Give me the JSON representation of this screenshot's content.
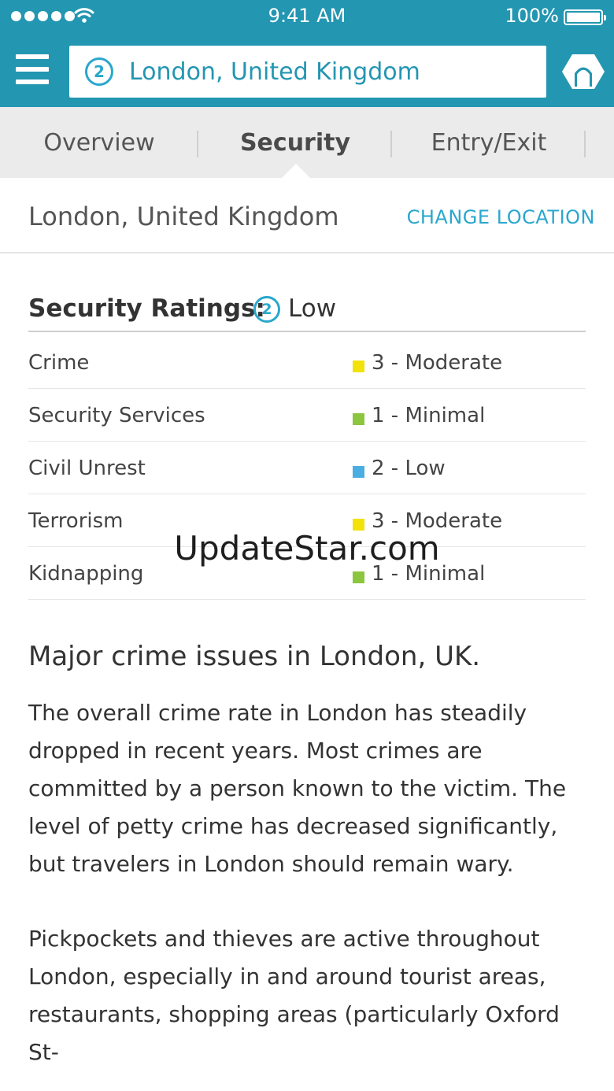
{
  "status_bar": {
    "time": "9:41 AM",
    "battery": "100%",
    "signal_icon": "signal-dots-icon",
    "wifi_icon": "wifi-icon",
    "battery_icon": "battery-icon"
  },
  "header": {
    "menu_icon": "hamburger-menu-icon",
    "search_rating": "2",
    "search_location": "London, United Kingdom",
    "logo_icon": "app-logo-icon",
    "bar_color": "#2396b1",
    "accent_color": "#2aa7cd"
  },
  "tabs": [
    {
      "label": "Overview",
      "active": false
    },
    {
      "label": "Security",
      "active": true
    },
    {
      "label": "Entry/Exit",
      "active": false
    }
  ],
  "location": {
    "name": "London, United Kingdom",
    "change_label": "CHANGE LOCATION"
  },
  "security": {
    "title": "Security Ratings:",
    "overall_rating": "2",
    "overall_level": "Low",
    "rows": [
      {
        "label": "Crime",
        "value": "3 - Moderate",
        "color": "#f2e20a"
      },
      {
        "label": "Security Services",
        "value": "1 - Minimal",
        "color": "#8cc63e"
      },
      {
        "label": "Civil Unrest",
        "value": "2 - Low",
        "color": "#4aaee2"
      },
      {
        "label": "Terrorism",
        "value": "3 - Moderate",
        "color": "#f2e20a"
      },
      {
        "label": "Kidnapping",
        "value": "1 - Minimal",
        "color": "#8cc63e"
      }
    ]
  },
  "watermark": "UpdateStar.com",
  "article": {
    "title": "Major crime issues in London, UK.",
    "paragraphs": [
      "The overall crime rate in London has steadily dropped in recent years. Most crimes are committed by a person known to the victim. The level of petty crime has decreased significantly, but travelers in London should remain wary.",
      "Pickpockets and thieves are active throughout London, especially in and around tourist areas, restaurants, shopping areas (particularly Oxford St-"
    ]
  }
}
